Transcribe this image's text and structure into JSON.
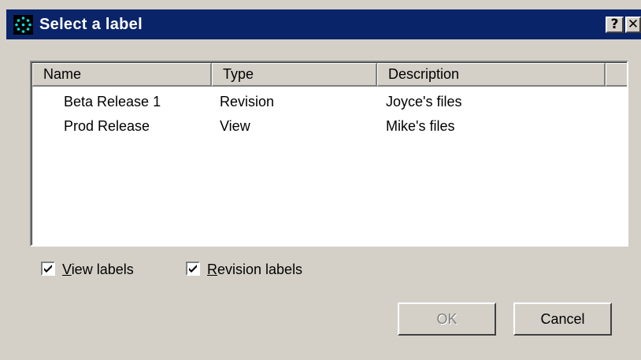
{
  "window": {
    "title": "Select a label",
    "help_glyph": "?",
    "close_glyph": "✕",
    "icon": "dots-app-icon"
  },
  "list": {
    "columns": [
      "Name",
      "Type",
      "Description"
    ],
    "rows": [
      {
        "name": "Beta Release 1",
        "type": "Revision",
        "description": "Joyce's files"
      },
      {
        "name": "Prod Release",
        "type": "View",
        "description": "Mike's files"
      }
    ]
  },
  "options": {
    "view_labels": {
      "prefix": "",
      "accel": "V",
      "rest": "iew labels",
      "checked": true
    },
    "revision_labels": {
      "prefix": "",
      "accel": "R",
      "rest": "evision labels",
      "checked": true
    }
  },
  "buttons": {
    "ok_label": "OK",
    "ok_enabled": false,
    "cancel_label": "Cancel"
  },
  "colors": {
    "titlebar": "#0a246a",
    "face": "#d4d0c8",
    "disabled_text": "#808080"
  }
}
